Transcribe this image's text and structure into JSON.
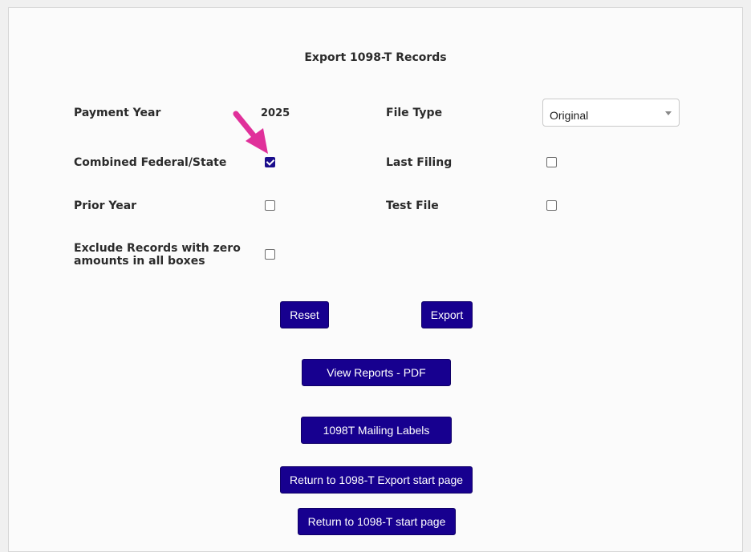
{
  "form": {
    "title": "Export 1098-T Records",
    "payment_year_label": "Payment Year",
    "payment_year_value": "2025",
    "file_type_label": "File Type",
    "file_type_selected": "Original",
    "combined_label": "Combined Federal/State",
    "combined_checked": true,
    "last_filing_label": "Last Filing",
    "last_filing_checked": false,
    "prior_year_label": "Prior Year",
    "prior_year_checked": false,
    "test_file_label": "Test File",
    "test_file_checked": false,
    "exclude_label_line1": "Exclude Records with zero",
    "exclude_label_line2": "amounts in all boxes",
    "exclude_checked": false
  },
  "buttons": {
    "reset": "Reset",
    "export": "Export",
    "view_reports": "View Reports - PDF",
    "mailing_labels": "1098T Mailing Labels",
    "return_export": "Return to 1098-T Export start page",
    "return_start": "Return to 1098-T start page"
  },
  "colors": {
    "button_bg": "#17008f",
    "annotation_arrow": "#e0309a"
  },
  "icons": {
    "annotation": "pink-arrow-pointer-icon",
    "dropdown": "chevron-down-icon"
  }
}
